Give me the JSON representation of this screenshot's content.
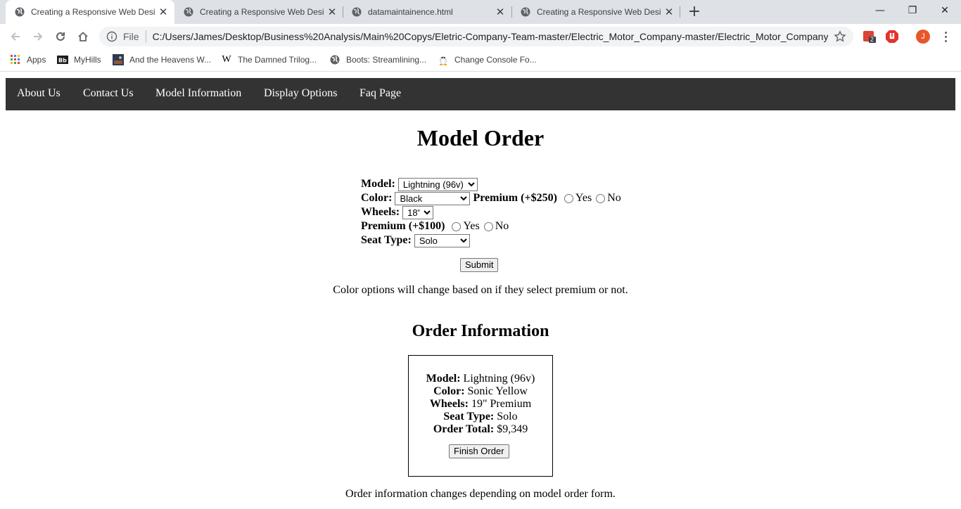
{
  "browser": {
    "tabs": [
      {
        "title": "Creating a Responsive Web Desig",
        "active": true
      },
      {
        "title": "Creating a Responsive Web Desig",
        "active": false
      },
      {
        "title": "datamaintainence.html",
        "active": false
      },
      {
        "title": "Creating a Responsive Web Desig",
        "active": false
      }
    ],
    "new_tab": "+",
    "window_controls": {
      "minimize": "—",
      "restore": "❐",
      "close": "✕"
    },
    "omnibox": {
      "scheme_label": "File",
      "url": "C:/Users/James/Desktop/Business%20Analysis/Main%20Copys/Eletric-Company-Team-master/Electric_Motor_Company-master/Electric_Motor_Company-..."
    },
    "extension_badge": "2",
    "profile_initial": "J",
    "bookmarks": [
      {
        "label": "Apps",
        "icon": "apps-grid-icon"
      },
      {
        "label": "MyHills",
        "icon": "blackboard-icon"
      },
      {
        "label": "And the Heavens W...",
        "icon": "book-cover-icon"
      },
      {
        "label": "The Damned Trilog...",
        "icon": "wikipedia-icon"
      },
      {
        "label": "Boots: Streamlining...",
        "icon": "globe-icon"
      },
      {
        "label": "Change Console Fo...",
        "icon": "tux-icon"
      }
    ]
  },
  "site": {
    "nav": [
      "About Us",
      "Contact Us",
      "Model Information",
      "Display Options",
      "Faq Page"
    ],
    "heading": "Model Order",
    "form": {
      "model_label": "Model:",
      "model_value": "Lightning (96v)",
      "color_label": "Color:",
      "color_value": "Black",
      "color_premium_label": "Premium (+$250)",
      "wheels_label": "Wheels:",
      "wheels_value": "18\"",
      "wheels_premium_label": "Premium (+$100)",
      "seat_label": "Seat Type:",
      "seat_value": "Solo",
      "yes": "Yes",
      "no": "No",
      "submit": "Submit"
    },
    "note_color": "Color options will change based on if they select premium or not.",
    "order_heading": "Order Information",
    "order": {
      "model_label": "Model:",
      "model_value": "Lightning (96v)",
      "color_label": "Color:",
      "color_value": "Sonic Yellow",
      "wheels_label": "Wheels:",
      "wheels_value": "19\" Premium",
      "seat_label": "Seat Type:",
      "seat_value": "Solo",
      "total_label": "Order Total:",
      "total_value": "$9,349",
      "finish": "Finish Order"
    },
    "note_order": "Order information changes depending on model order form."
  }
}
